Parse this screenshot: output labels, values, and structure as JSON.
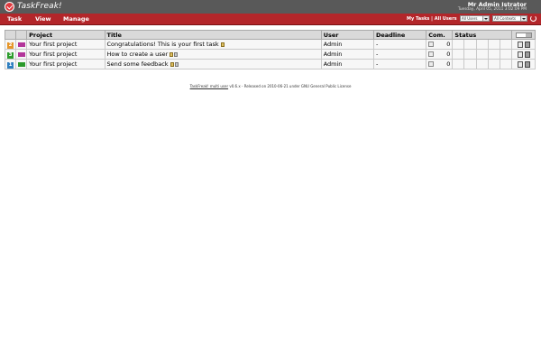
{
  "app": {
    "logo_text": "TaskFreak!",
    "user_name": "Mr Admin Istrator",
    "date_time": "Tuesday, April 05, 2011 3:02:09 PM"
  },
  "menu": {
    "items": [
      {
        "label": "Task"
      },
      {
        "label": "View"
      },
      {
        "label": "Manage"
      }
    ],
    "my_tasks": "My Tasks",
    "separator": "|",
    "all_users": "All Users",
    "users_select": "All Users",
    "contexts_select": "All Contexts"
  },
  "table": {
    "headers": [
      "",
      "",
      "Project",
      "Title",
      "User",
      "Deadline",
      "Com.",
      "Status",
      "",
      "",
      "",
      "",
      ""
    ],
    "rows": [
      {
        "priority": "2",
        "priority_color": "#e6962a",
        "context_color": "#b3359a",
        "project": "Your first project",
        "title": "Congratulations! This is your first task",
        "user": "Admin",
        "deadline": "-",
        "comments": "0"
      },
      {
        "priority": "3",
        "priority_color": "#2e9d2e",
        "context_color": "#b3359a",
        "project": "Your first project",
        "title": "How to create a user",
        "user": "Admin",
        "deadline": "-",
        "comments": "0"
      },
      {
        "priority": "1",
        "priority_color": "#2f7fc0",
        "context_color": "#2c9a2c",
        "project": "Your first project",
        "title": "Send some feedback",
        "user": "Admin",
        "deadline": "-",
        "comments": "0"
      }
    ]
  },
  "footer": {
    "link": "TaskFreak! multi user",
    "text": " v0.6.x - Released on 2010-06-21 under GNU General Public License"
  },
  "colors": {
    "top_bar": "#595959",
    "menu_bar": "#b3262a",
    "header_bg": "#d9d9d9"
  }
}
